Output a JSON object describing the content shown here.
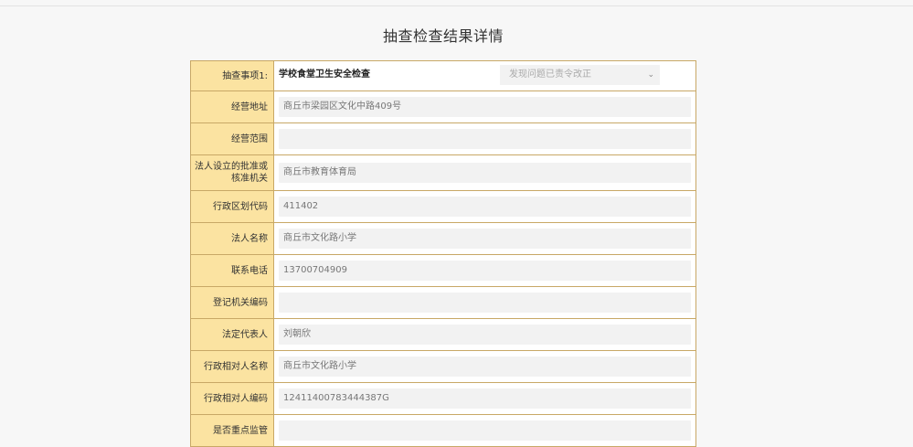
{
  "page": {
    "title": "抽查检查结果详情"
  },
  "inspection": {
    "label": "抽查事项1:",
    "item": "学校食堂卫生安全检查",
    "result_selected": "发现问题已责令改正",
    "result_icon": "chevron-down-icon"
  },
  "rows": [
    {
      "label": "经营地址",
      "value": "商丘市梁园区文化中路409号"
    },
    {
      "label": "经营范围",
      "value": ""
    },
    {
      "label": "法人设立的批准或核准机关",
      "value": "商丘市教育体育局"
    },
    {
      "label": "行政区划代码",
      "value": "411402"
    },
    {
      "label": "法人名称",
      "value": "商丘市文化路小学"
    },
    {
      "label": "联系电话",
      "value": "13700704909"
    },
    {
      "label": "登记机关编码",
      "value": ""
    },
    {
      "label": "法定代表人",
      "value": "刘朝欣"
    },
    {
      "label": "行政相对人名称",
      "value": "商丘市文化路小学"
    },
    {
      "label": "行政相对人编码",
      "value": "12411400783444387G"
    },
    {
      "label": "是否重点监管",
      "value": ""
    }
  ],
  "colors": {
    "label_bg": "#fbe3a1",
    "border": "#c8a866",
    "field_bg": "#f2f2f2"
  }
}
